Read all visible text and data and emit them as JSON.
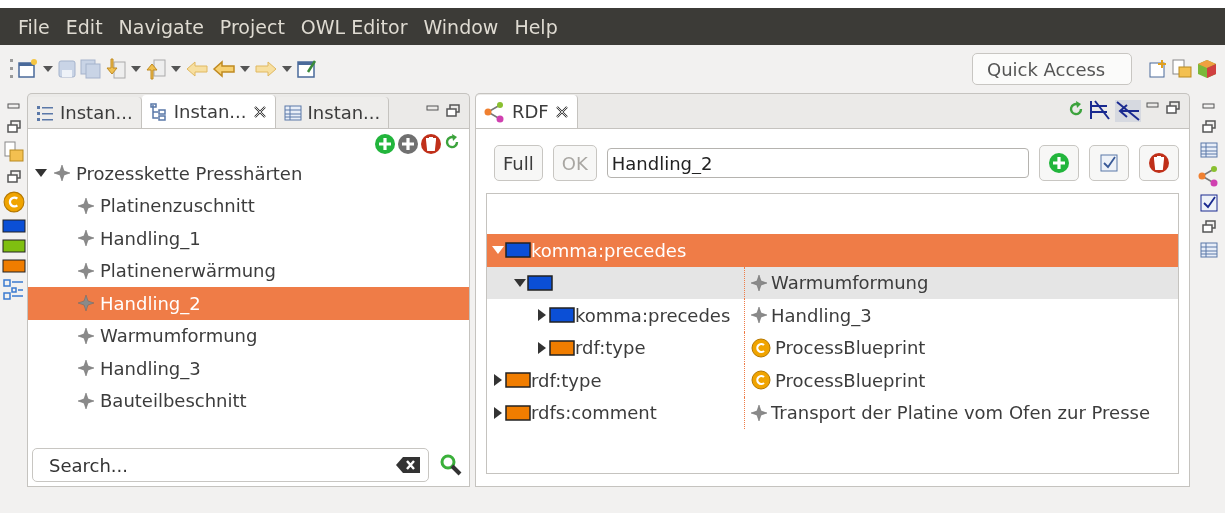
{
  "menu": [
    "File",
    "Edit",
    "Navigate",
    "Project",
    "OWL Editor",
    "Window",
    "Help"
  ],
  "quick_access": {
    "placeholder": "Quick Access"
  },
  "left_view": {
    "tabs": [
      {
        "label": "Instan...",
        "kind": "list",
        "selected": false
      },
      {
        "label": "Instan...",
        "kind": "tree",
        "selected": true
      },
      {
        "label": "Instan...",
        "kind": "table",
        "selected": false
      }
    ],
    "tree": {
      "label": "Prozesskette Presshärten",
      "expanded": true,
      "children": [
        {
          "label": "Platinenzuschnitt",
          "selected": false
        },
        {
          "label": "Handling_1",
          "selected": false
        },
        {
          "label": "Platinenerwärmung",
          "selected": false
        },
        {
          "label": "Handling_2",
          "selected": true
        },
        {
          "label": "Warmumformung",
          "selected": false
        },
        {
          "label": "Handling_3",
          "selected": false
        },
        {
          "label": "Bauteilbeschnitt",
          "selected": false
        }
      ]
    },
    "search": {
      "placeholder": "Search..."
    }
  },
  "rdf_view": {
    "tab": "RDF",
    "full_button": "Full",
    "ok_button": {
      "label": "OK",
      "disabled": true
    },
    "resource_field": "Handling_2",
    "rows": [
      {
        "property": "komma:precedes",
        "color": "#0b4fd6",
        "expanded": true,
        "selected": true,
        "highlighted": false,
        "children": [
          {
            "color": "#0b4fd6",
            "expanded": true,
            "selected": false,
            "highlighted": true,
            "value": "Warmumformung",
            "kind": "instance",
            "children": [
              {
                "property": "komma:precedes",
                "color": "#0b4fd6",
                "expanded": false,
                "selected": false,
                "highlighted": false,
                "value": "Handling_3",
                "kind": "instance"
              },
              {
                "property": "rdf:type",
                "color": "#f07d00",
                "expanded": false,
                "selected": false,
                "highlighted": false,
                "value": "ProcessBlueprint",
                "kind": "class"
              }
            ]
          }
        ]
      },
      {
        "property": "rdf:type",
        "color": "#f07d00",
        "expanded": false,
        "selected": false,
        "highlighted": false,
        "value": "ProcessBlueprint",
        "kind": "class"
      },
      {
        "property": "rdfs:comment",
        "color": "#f07d00",
        "expanded": false,
        "selected": false,
        "highlighted": false,
        "value": "Transport der Platine vom Ofen zur Presse",
        "kind": "instance"
      }
    ]
  }
}
